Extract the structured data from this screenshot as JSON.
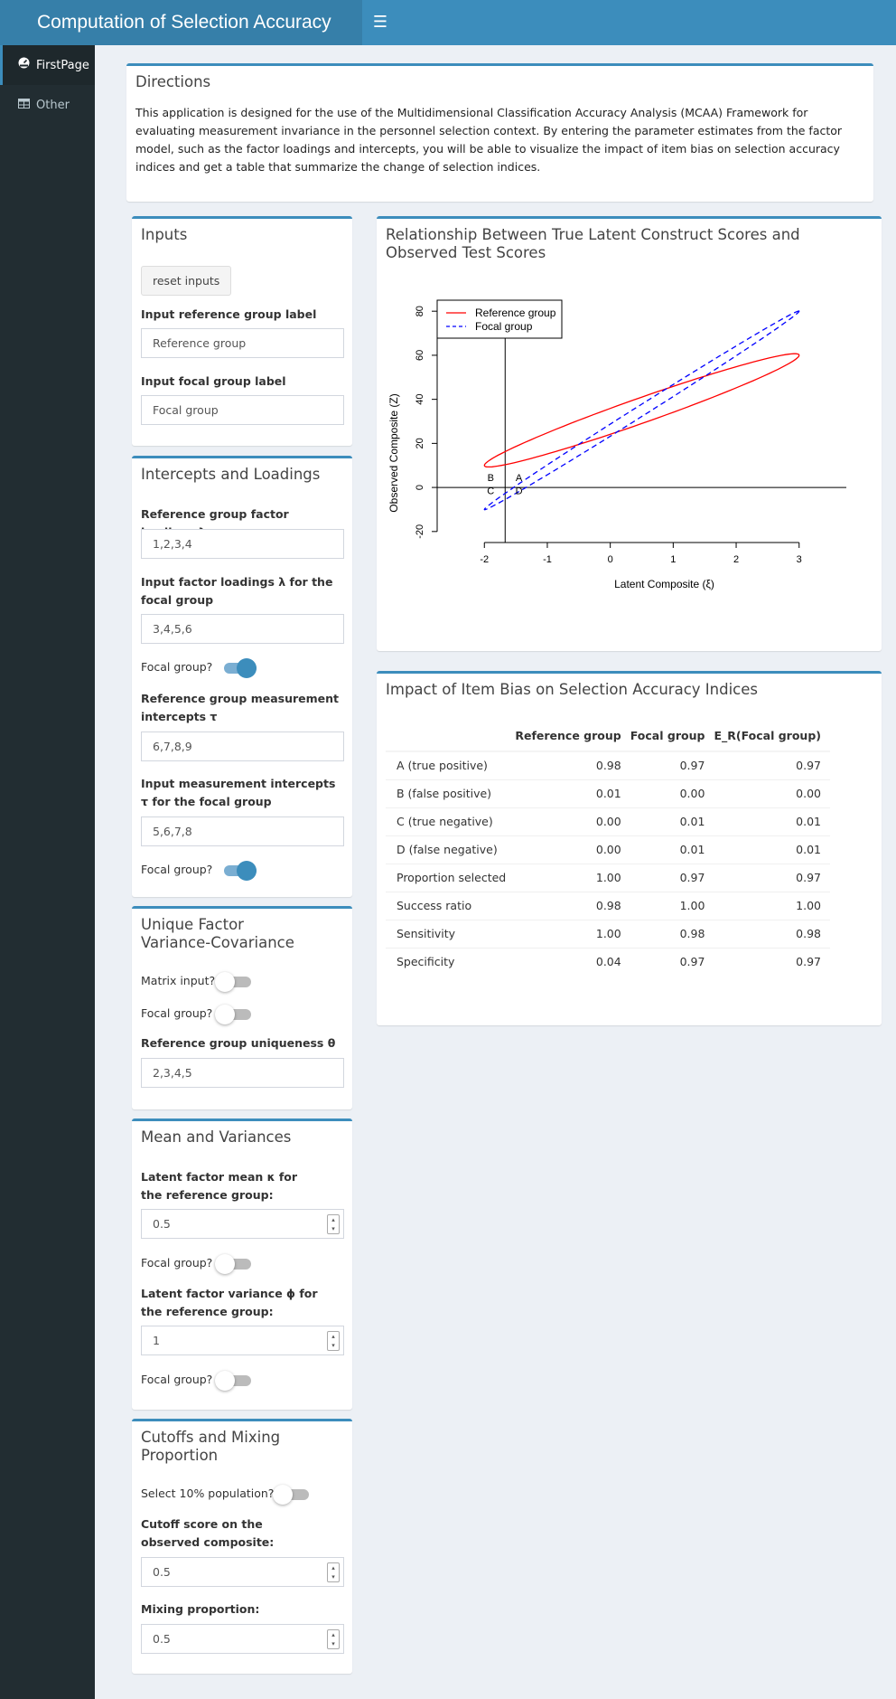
{
  "app": {
    "title": "Computation of Selection Accuracy",
    "menu_icon": "hamburger-icon"
  },
  "sidebar": {
    "items": [
      {
        "label": "FirstPage",
        "icon": "dashboard-icon",
        "active": true
      },
      {
        "label": "Other",
        "icon": "table-icon",
        "active": false
      }
    ]
  },
  "directions": {
    "title": "Directions",
    "text": "This application is designed for the use of the Multidimensional Classification Accuracy Analysis (MCAA) Framework for evaluating measurement invariance in the personnel selection context. By entering the parameter estimates from the factor model, such as the factor loadings and intercepts, you will be able to visualize the impact of item bias on selection accuracy indices and get a table that summarize the change of selection indices."
  },
  "inputs": {
    "title": "Inputs",
    "reset_label": "reset inputs",
    "ref_label_title": "Input reference group label",
    "ref_label_value": "Reference group",
    "focal_label_title": "Input focal group label",
    "focal_label_value": "Focal group"
  },
  "intercepts": {
    "title": "Intercepts and Loadings",
    "ref_loadings_title": "Reference group factor loadings λ",
    "ref_loadings_value": "1,2,3,4",
    "focal_loadings_title": "Input factor loadings λ for the focal group",
    "focal_loadings_value": "3,4,5,6",
    "toggle1_label": "Focal group?",
    "toggle1_on": true,
    "ref_intercepts_title": "Reference group measurement intercepts τ",
    "ref_intercepts_value": "6,7,8,9",
    "focal_intercepts_title": "Input measurement intercepts τ for the focal group",
    "focal_intercepts_value": "5,6,7,8",
    "toggle2_label": "Focal group?",
    "toggle2_on": true
  },
  "unique": {
    "title": "Unique Factor Variance-Covariance",
    "matrix_label": "Matrix input?",
    "matrix_on": false,
    "focal_label": "Focal group?",
    "focal_on": false,
    "uniq_title": "Reference group uniqueness θ",
    "uniq_value": "2,3,4,5"
  },
  "meanvar": {
    "title": "Mean and Variances",
    "mean_title": "Latent factor mean κ for the reference group:",
    "mean_value": "0.5",
    "focal1_label": "Focal group?",
    "focal1_on": false,
    "var_title": "Latent factor variance ϕ for the reference group:",
    "var_value": "1",
    "focal2_label": "Focal group?",
    "focal2_on": false
  },
  "cutoffs": {
    "title": "Cutoffs and Mixing Proportion",
    "select_label": "Select 10% population?",
    "select_on": false,
    "cutoff_title": "Cutoff score on the observed composite:",
    "cutoff_value": "0.5",
    "mix_title": "Mixing proportion:",
    "mix_value": "0.5"
  },
  "plot_box": {
    "title": "Relationship Between True Latent Construct Scores and Observed Test Scores"
  },
  "chart_data": {
    "type": "scatter",
    "title": "",
    "xlabel": "Latent Composite (ξ)",
    "ylabel": "Observed Composite (Z)",
    "xlim": [
      -2.75,
      3.75
    ],
    "ylim": [
      -25,
      85
    ],
    "x_ticks": [
      -2,
      -1,
      0,
      1,
      2,
      3
    ],
    "y_ticks": [
      -20,
      0,
      20,
      40,
      60,
      80
    ],
    "series": [
      {
        "name": "Reference group",
        "color": "#ff0000",
        "style": "solid",
        "ellipse": {
          "center": [
            0.5,
            35
          ],
          "extreme_left": [
            -2.0,
            10
          ],
          "extreme_right": [
            3.0,
            60
          ],
          "top_extreme": [
            2.5,
            61
          ],
          "bottom_extreme": [
            -1.5,
            9
          ]
        }
      },
      {
        "name": "Focal group",
        "color": "#0000ff",
        "style": "dashed",
        "ellipse": {
          "center": [
            0.5,
            35
          ],
          "extreme_left": [
            -2.0,
            -10
          ],
          "extreme_right": [
            3.0,
            80
          ],
          "top_extreme": [
            2.9,
            81
          ],
          "bottom_extreme": [
            -1.9,
            -11
          ]
        }
      }
    ],
    "reference_lines": {
      "vertical_x": -1.67,
      "horizontal_y": 0
    },
    "quadrant_labels": [
      {
        "text": "A",
        "x": -1.45,
        "y": 3
      },
      {
        "text": "B",
        "x": -1.9,
        "y": 3
      },
      {
        "text": "C",
        "x": -1.9,
        "y": -3
      },
      {
        "text": "D",
        "x": -1.45,
        "y": -3
      }
    ],
    "legend": "top-left"
  },
  "impact": {
    "title": "Impact of Item Bias on Selection Accuracy Indices",
    "columns": [
      "",
      "Reference group",
      "Focal group",
      "E_R(Focal group)"
    ],
    "rows": [
      [
        "A (true positive)",
        "0.98",
        "0.97",
        "0.97"
      ],
      [
        "B (false positive)",
        "0.01",
        "0.00",
        "0.00"
      ],
      [
        "C (true negative)",
        "0.00",
        "0.01",
        "0.01"
      ],
      [
        "D (false negative)",
        "0.00",
        "0.01",
        "0.01"
      ],
      [
        "Proportion selected",
        "1.00",
        "0.97",
        "0.97"
      ],
      [
        "Success ratio",
        "0.98",
        "1.00",
        "1.00"
      ],
      [
        "Sensitivity",
        "1.00",
        "0.98",
        "0.98"
      ],
      [
        "Specificity",
        "0.04",
        "0.97",
        "0.97"
      ]
    ]
  },
  "colors": {
    "header": "#3c8dbc",
    "logo": "#367fa9",
    "sidebar": "#222d32",
    "background": "#ecf0f5"
  }
}
